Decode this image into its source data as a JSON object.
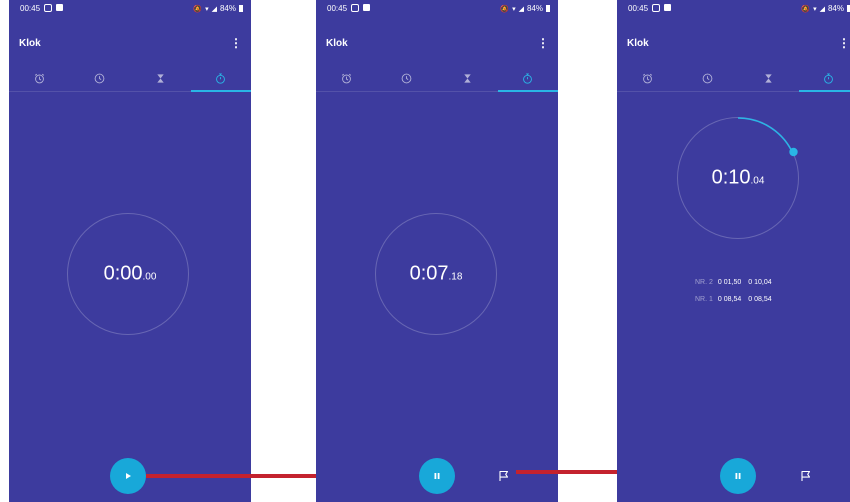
{
  "status": {
    "time": "00:45",
    "battery": "84%"
  },
  "app": {
    "title": "Klok"
  },
  "tabs": [
    "alarm",
    "clock",
    "timer",
    "stopwatch"
  ],
  "screens": [
    {
      "time_main": "0:00",
      "time_ms": ".00",
      "fab": "play"
    },
    {
      "time_main": "0:07",
      "time_ms": ".18",
      "fab": "pause"
    },
    {
      "time_main": "0:10",
      "time_ms": ".04",
      "fab": "pause"
    }
  ],
  "laps": [
    {
      "nr": "NR. 2",
      "lap": "0 01,50",
      "total": "0 10,04"
    },
    {
      "nr": "NR. 1",
      "lap": "0 08,54",
      "total": "0 08,54"
    }
  ],
  "colors": {
    "background": "#3d3b9e",
    "accent": "#18a8d9",
    "arrow": "#c4222e"
  }
}
